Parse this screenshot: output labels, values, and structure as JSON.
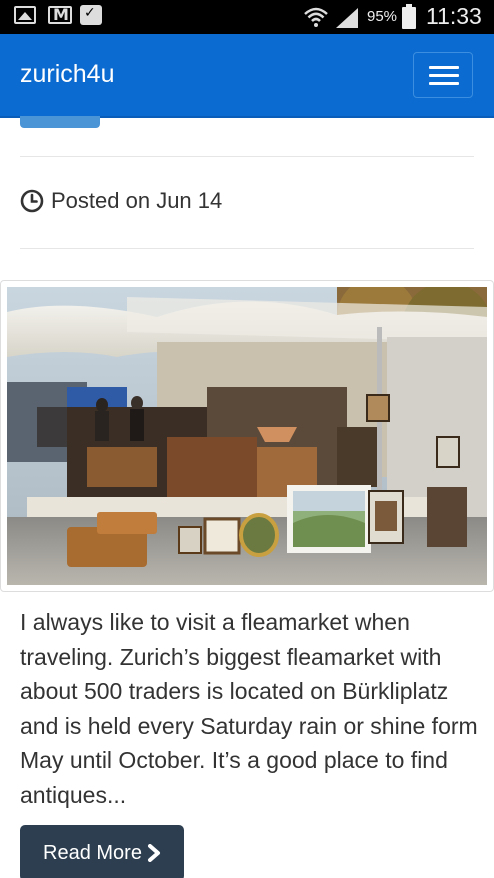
{
  "status_bar": {
    "battery_percent": "95%",
    "time": "11:33",
    "icons": [
      "image-icon",
      "gmail-icon",
      "shopping-bag-icon",
      "wifi-icon",
      "signal-icon",
      "battery-icon"
    ]
  },
  "navbar": {
    "brand": "zurich4u",
    "toggle_icon": "hamburger-menu-icon",
    "background": "#0c6bd0"
  },
  "post": {
    "posted_label": "Posted on Jun 14",
    "clock_icon": "clock-icon",
    "image_alt": "Flea market stall with antiques and framed paintings",
    "excerpt": "I always like to visit a fleamarket when traveling. Zurich’s biggest fleamarket with about 500 traders is located on Bürkliplatz and is held every Saturday rain or shine form May until October. It’s a good place to find antiques...",
    "read_more_label": "Read More",
    "read_more_icon": "chevron-right-icon",
    "button_color": "#2c3e50"
  }
}
